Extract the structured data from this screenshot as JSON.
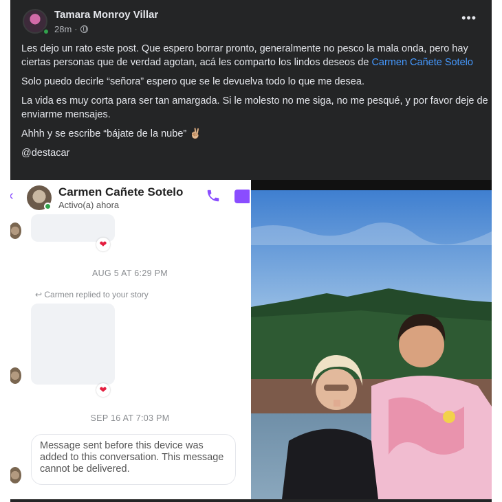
{
  "post": {
    "author": "Tamara Monroy Villar",
    "time": "28m",
    "visibility_icon": "globe-icon",
    "more_icon": "more-horizontal-icon",
    "paragraphs": [
      {
        "before": "Les dejo un rato este post. Que espero borrar pronto, generalmente no pesco la mala onda, pero hay ciertas personas que de verdad agotan, acá les comparto los lindos deseos de ",
        "mention": "Carmen Cañete Sotelo"
      },
      {
        "text": "Solo puedo decirle “señora” espero que se le devuelva todo lo que me desea."
      },
      {
        "text": "La vida es muy corta para ser tan amargada. Si le molesto no me siga, no me pesqué, y por favor deje de enviarme mensajes."
      },
      {
        "text": "Ahhh y se escribe “bájate de la nube” ✌🏼"
      },
      {
        "text": "@destacar"
      }
    ]
  },
  "chat": {
    "contact_name": "Carmen Cañete Sotelo",
    "status": "Activo(a) ahora",
    "timestamp_1": "AUG 5 AT 6:29 PM",
    "replied_note": "Carmen replied to your story",
    "timestamp_2": "SEP 16 AT 7:03 PM",
    "system_message": "Message sent before this device was added to this conversation. This message cannot be delivered.",
    "reaction": "❤",
    "accent_color": "#8a4dff"
  },
  "photo": {
    "description_icon": "photo-image"
  }
}
